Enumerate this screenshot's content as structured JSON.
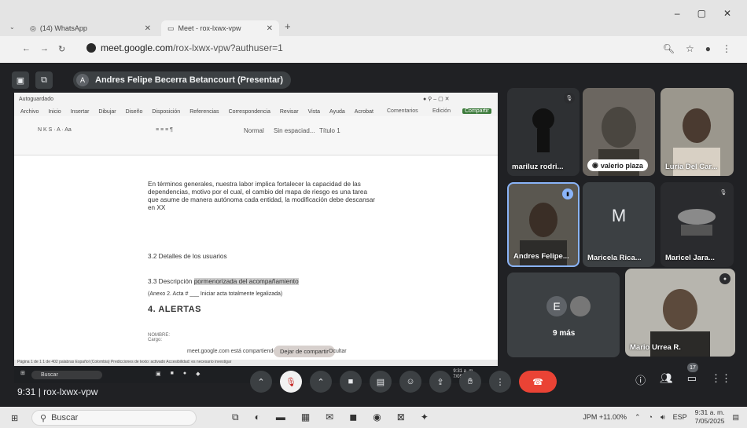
{
  "browser": {
    "tabs": [
      {
        "title": "(14) WhatsApp"
      },
      {
        "title": "Meet - rox-lxwx-vpw"
      }
    ],
    "url_host": "meet.google.com",
    "url_path": "/rox-lxwx-vpw?authuser=1"
  },
  "meet": {
    "presenter": {
      "avatar_letter": "A",
      "label": "Andres Felipe Becerra Betancourt (Presentar)"
    },
    "meeting_code": "9:31 | rox-lxwx-vpw",
    "participants": [
      {
        "name": "mariluz rodri..."
      },
      {
        "name": "valerio plaza"
      },
      {
        "name": "Luria Del Car..."
      },
      {
        "name": "Andres Felipe..."
      },
      {
        "name": "Maricela Rica...",
        "letter": "M"
      },
      {
        "name": "Maricel Jara..."
      },
      {
        "name": "Mario Urrea R."
      }
    ],
    "more": {
      "letter": "E",
      "label": "9 más"
    },
    "people_count": "17"
  },
  "shared_screen": {
    "word": {
      "autosave": "Autoguardado",
      "menu": [
        "Archivo",
        "Inicio",
        "Insertar",
        "Dibujar",
        "Diseño",
        "Disposición",
        "Referencias",
        "Correspondencia",
        "Revisar",
        "Vista",
        "Ayuda",
        "Acrobat"
      ],
      "comments": "Comentarios",
      "edit": "Edición",
      "share": "Compartir",
      "style_normal": "Normal",
      "style_nospacing": "Sin espaciad...",
      "style_title": "Título 1"
    },
    "doc": {
      "paragraph": "En términos generales, nuestra labor implica fortalecer la capacidad de las dependencias, motivo por el cual, el cambio del mapa de riesgo es una tarea que asume de manera autónoma cada entidad, la modificación debe descansar en XX",
      "section1": "3.2 Detalles de los usuarios",
      "section2_a": "3.3 Descripción ",
      "section2_b": "pormenorizada del acompañamiento",
      "annex": "(Anexo 2. Acta # ___ Iniciar acta totalmente legalizada)",
      "heading4": "4. ALERTAS",
      "note": "NOMBRE:\nCargo:"
    },
    "share_msg": "meet.google.com está compartiendo la pantalla.",
    "stop_share": "Dejar de compartir",
    "hide": "Ocultar",
    "status": "Página 1 de 1   1 de 402 palabras   Español (Colombia)   Predicciones de texto: activado   Accesibilidad: es necesario investigar",
    "taskbar_search": "Buscar",
    "time": "9:31 a. m.",
    "date": "7/05/2025"
  },
  "taskbar": {
    "search_placeholder": "Buscar",
    "weather": "JPM +11.00%",
    "lang": "ESP",
    "time": "9:31 a. m.",
    "date": "7/05/2025"
  }
}
